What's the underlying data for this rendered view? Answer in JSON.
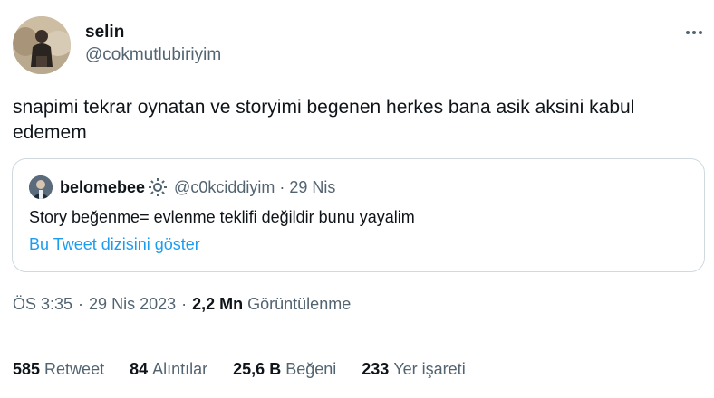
{
  "author": {
    "display_name": "selin",
    "handle": "@cokmutlubiriyim"
  },
  "tweet": {
    "text": "snapimi tekrar oynatan ve storyimi begenen herkes bana asik aksini kabul edemem"
  },
  "quoted": {
    "display_name": "belomebee",
    "handle": "@c0kciddiyim",
    "separator": "·",
    "date": "29 Nis",
    "text": "Story beğenme= evlenme teklifi değildir bunu yayalim",
    "thread_link": "Bu Tweet dizisini göster"
  },
  "meta": {
    "time": "ÖS 3:35",
    "separator": "·",
    "date": "29 Nis 2023",
    "views_count": "2,2 Mn",
    "views_label": "Görüntülenme"
  },
  "stats": [
    {
      "count": "585",
      "label": "Retweet"
    },
    {
      "count": "84",
      "label": "Alıntılar"
    },
    {
      "count": "25,6 B",
      "label": "Beğeni"
    },
    {
      "count": "233",
      "label": "Yer işareti"
    }
  ],
  "colors": {
    "text": "#0f1419",
    "secondary": "#536471",
    "link": "#1d9bf0",
    "border": "#cfd9de"
  },
  "icons": {
    "more": "more-horizontal-icon",
    "badge": "gear-badge-icon"
  }
}
